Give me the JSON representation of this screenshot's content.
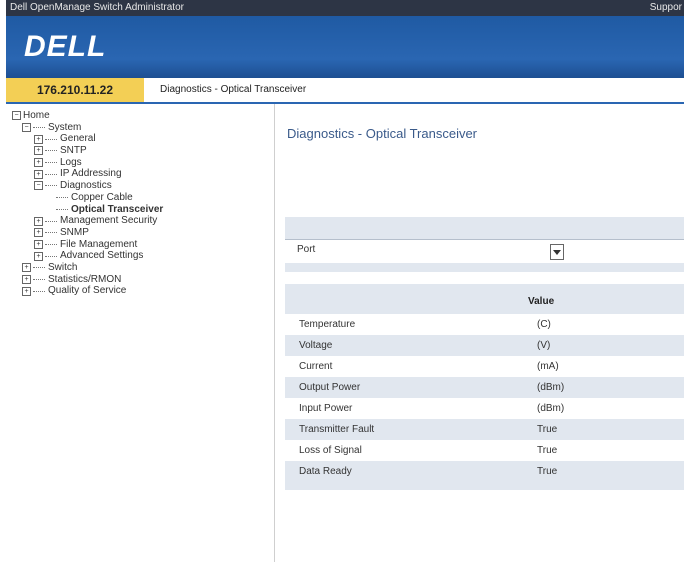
{
  "titlebar": {
    "app_title": "Dell OpenManage Switch Administrator",
    "support": "Suppor"
  },
  "brand": {
    "logo": "DELL"
  },
  "nav": {
    "ip": "176.210.11.22",
    "breadcrumb": "Diagnostics - Optical Transceiver"
  },
  "tree": {
    "home": "Home",
    "system": "System",
    "general": "General",
    "sntp": "SNTP",
    "logs": "Logs",
    "ip_addressing": "IP Addressing",
    "diagnostics": "Diagnostics",
    "copper_cable": "Copper Cable",
    "optical_transceiver": "Optical Transceiver",
    "management_security": "Management Security",
    "snmp": "SNMP",
    "file_management": "File Management",
    "advanced_settings": "Advanced Settings",
    "switch": "Switch",
    "statistics_rmon": "Statistics/RMON",
    "qos": "Quality of Service"
  },
  "main": {
    "title": "Diagnostics - Optical Transceiver",
    "port_label": "Port",
    "value_header": "Value",
    "rows": [
      {
        "k": "Temperature",
        "v": "(C)"
      },
      {
        "k": "Voltage",
        "v": "(V)"
      },
      {
        "k": "Current",
        "v": "(mA)"
      },
      {
        "k": "Output Power",
        "v": "(dBm)"
      },
      {
        "k": "Input Power",
        "v": "(dBm)"
      },
      {
        "k": "Transmitter Fault",
        "v": "True"
      },
      {
        "k": "Loss of Signal",
        "v": "True"
      },
      {
        "k": "Data Ready",
        "v": "True"
      }
    ]
  },
  "colors": {
    "banner": "#2a66b2",
    "ip_box": "#f3cf55",
    "panel": "#e1e7ef",
    "title": "#3a5a8a"
  },
  "icons": {
    "expand": "plus-box-icon",
    "collapse": "minus-box-icon",
    "dropdown": "chevron-down-icon"
  }
}
